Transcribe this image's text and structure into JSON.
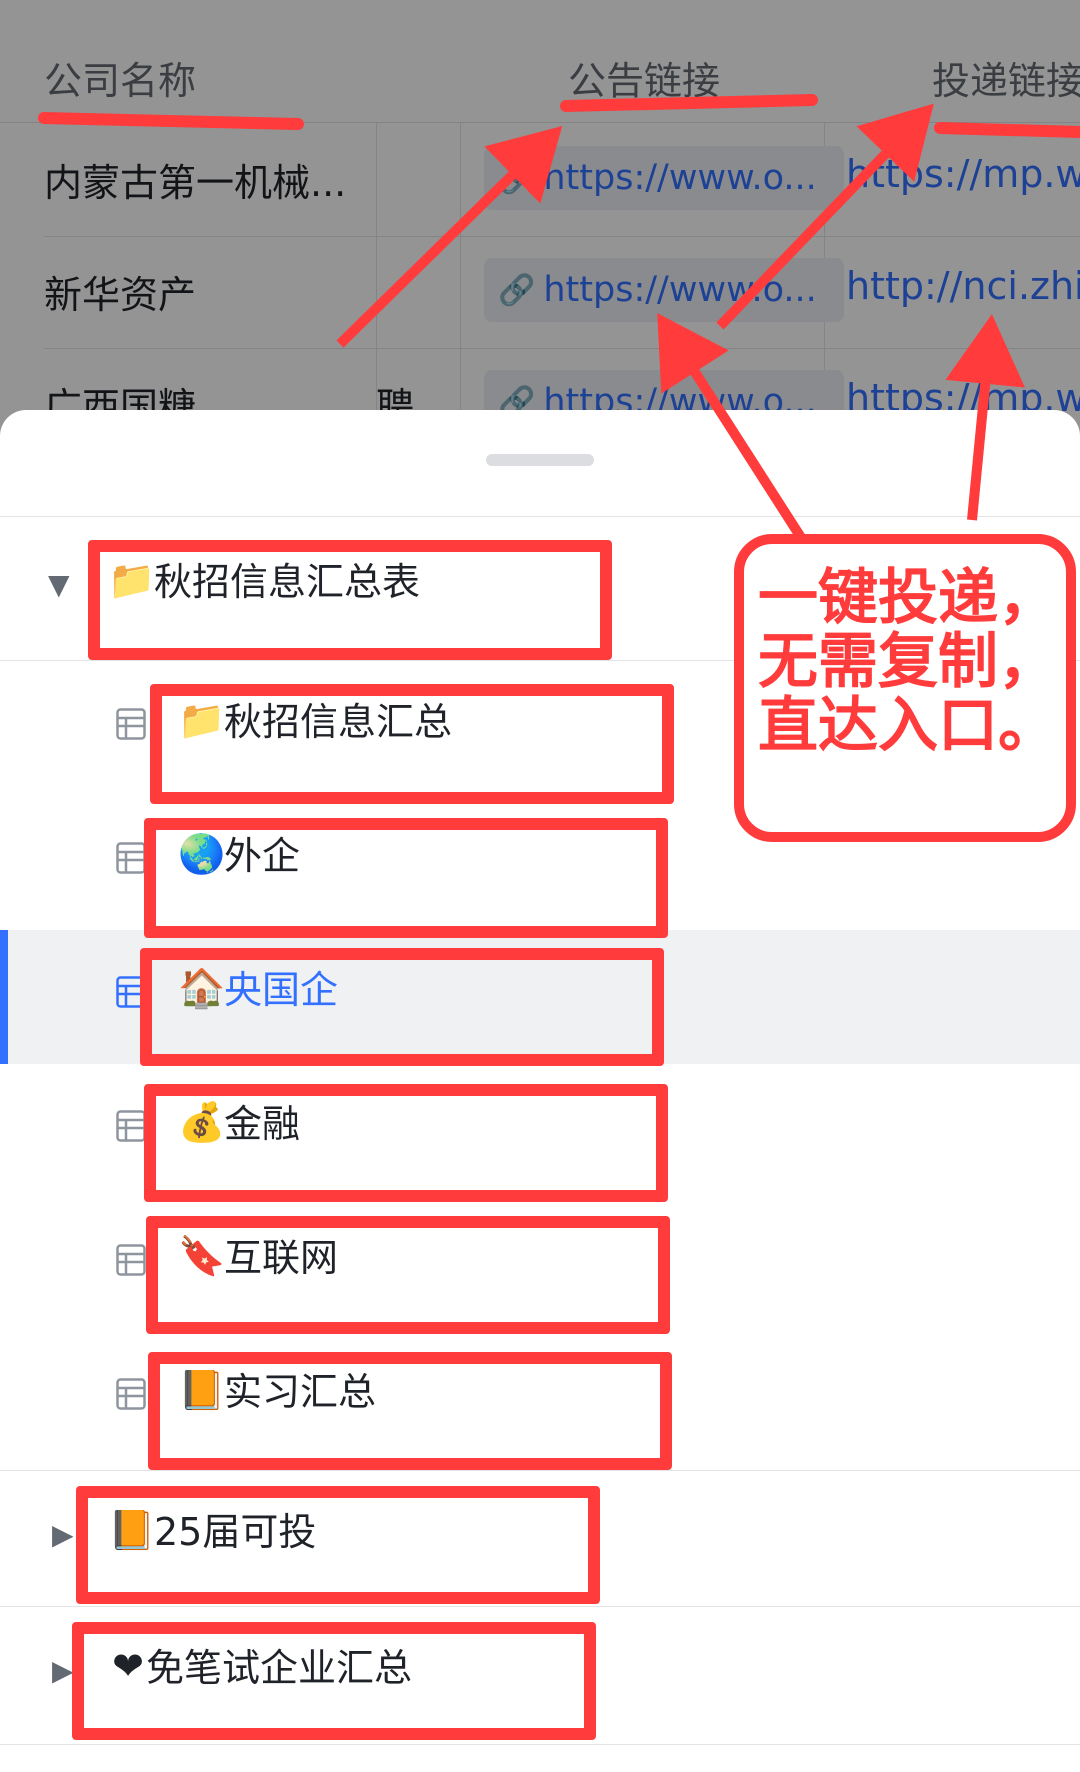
{
  "table": {
    "headers": [
      "公司名称",
      "公告链接",
      "投递链接"
    ],
    "rows": [
      {
        "name": "内蒙古第一机械...",
        "link": "https://www.o...",
        "deliver": "https://mp.we"
      },
      {
        "name": "新华资产",
        "link": "https://www.o...",
        "deliver": "http://nci.zhiy"
      },
      {
        "name": "广西国糖",
        "link": "https://www.o...",
        "deliver": "https://mp.we"
      }
    ],
    "peek_text": "聘"
  },
  "tree": {
    "nodes": [
      {
        "label": "秋招信息汇总表",
        "icon": "folder-icon",
        "emoji": "📁",
        "expanded": true
      },
      {
        "label": "秋招信息汇总",
        "icon": "folder-icon",
        "emoji": "📁"
      },
      {
        "label": "外企",
        "icon": "globe-icon",
        "emoji": "🌏"
      },
      {
        "label": "央国企",
        "icon": "house-icon",
        "emoji": "🏠",
        "selected": true
      },
      {
        "label": "金融",
        "icon": "money-bag-icon",
        "emoji": "💰"
      },
      {
        "label": "互联网",
        "icon": "bookmark-icon",
        "emoji": "🔖"
      },
      {
        "label": "实习汇总",
        "icon": "book-icon",
        "emoji": "📙"
      },
      {
        "label": "25届可投",
        "icon": "book-icon",
        "emoji": "📙",
        "expanded": false
      },
      {
        "label": "免笔试企业汇总",
        "icon": "heart-icon",
        "emoji": "❤",
        "expanded": false
      }
    ]
  },
  "annotation": {
    "callout_lines": [
      "一键投递，",
      "无需复制，",
      "直达入口。"
    ],
    "color": "#ff3b3b"
  },
  "colors": {
    "accent": "#3370ff",
    "annotation": "#ff3b3b",
    "selected_bg": "#f0f1f3"
  }
}
